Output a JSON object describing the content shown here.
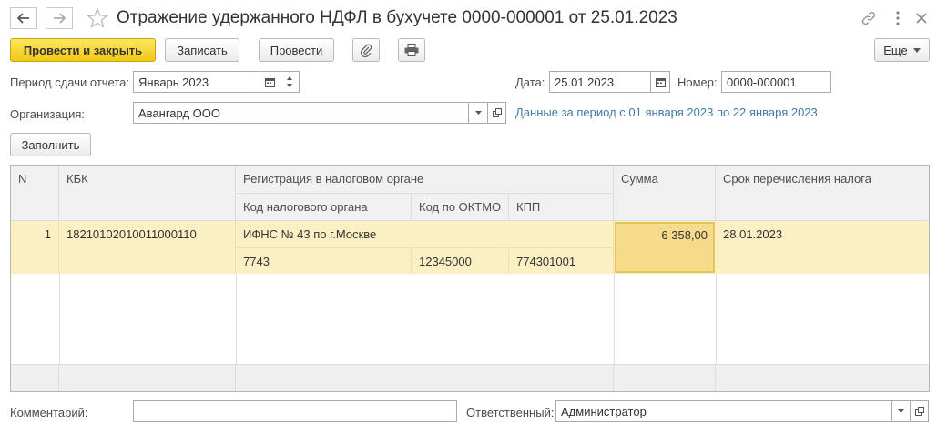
{
  "window": {
    "title": "Отражение удержанного НДФЛ в бухучете 0000-000001 от 25.01.2023",
    "back_icon": "arrow-left-icon",
    "forward_icon": "arrow-right-icon",
    "favorite_icon": "star-icon",
    "link_icon": "link-icon",
    "menu_icon": "kebab-menu-icon",
    "close_icon": "close-icon"
  },
  "toolbar": {
    "post_close_label": "Провести и закрыть",
    "save_label": "Записать",
    "post_label": "Провести",
    "attach_icon": "paperclip-icon",
    "print_icon": "printer-icon",
    "more_label": "Еще"
  },
  "form": {
    "period_label": "Период сдачи отчета:",
    "period_value": "Январь 2023",
    "date_label": "Дата:",
    "date_value": "25.01.2023",
    "number_label": "Номер:",
    "number_value": "0000-000001",
    "org_label": "Организация:",
    "org_value": "Авангард ООО",
    "period_info": "Данные за период с 01 января 2023 по 22 января 2023",
    "fill_label": "Заполнить"
  },
  "table": {
    "headers": {
      "n": "N",
      "kbk": "КБК",
      "registration": "Регистрация в налоговом органе",
      "tax_office_code": "Код налогового органа",
      "oktmo": "Код по ОКТМО",
      "kpp": "КПП",
      "amount": "Сумма",
      "due_date": "Срок перечисления налога"
    },
    "rows": [
      {
        "n": "1",
        "kbk": "18210102010011000110",
        "registration": "ИФНС № 43 по г.Москве",
        "tax_office_code": "7743",
        "oktmo": "12345000",
        "kpp": "774301001",
        "amount": "6 358,00",
        "due_date": "28.01.2023"
      }
    ]
  },
  "footer": {
    "comment_label": "Комментарий:",
    "comment_value": "",
    "responsible_label": "Ответственный:",
    "responsible_value": "Администратор"
  },
  "colors": {
    "primary_button": "#f2c715",
    "selected_row": "#fbf0c3",
    "selected_cell": "#f6dc8a",
    "link": "#3f7aa5"
  }
}
